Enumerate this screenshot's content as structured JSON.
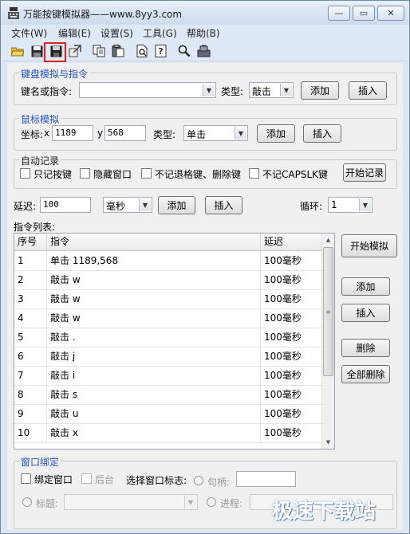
{
  "window": {
    "title": "万能按键模拟器——www.8yy3.com",
    "minimize_glyph": "—",
    "maximize_glyph": "▭",
    "close_glyph": "✕"
  },
  "menu": [
    "文件(W)",
    "编辑(E)",
    "设置(S)",
    "工具(G)",
    "帮助(B)"
  ],
  "toolbar": {
    "icons": [
      "open-folder-icon",
      "save-icon",
      "save-as-icon",
      "export-icon",
      "copy-icon",
      "paste-icon",
      "preview-icon",
      "help-icon",
      "search-icon",
      "tool-icon"
    ],
    "highlight_color": "#e02020"
  },
  "keyboard": {
    "title": "键盘模拟与指令",
    "key_label": "键名或指令:",
    "key_value": "",
    "type_label": "类型:",
    "type_value": "敲击",
    "add": "添加",
    "insert": "插入"
  },
  "mouse": {
    "title": "鼠标模拟",
    "coord_label": "坐标:",
    "x_label": "x",
    "x_value": "1189",
    "y_label": "y",
    "y_value": "568",
    "type_label": "类型:",
    "type_value": "单击",
    "add": "添加",
    "insert": "插入"
  },
  "autorec": {
    "title": "自动记录",
    "options": [
      "只记按键",
      "隐藏窗口",
      "不记退格键、删除键",
      "不记CAPSLK键"
    ],
    "start": "开始记录"
  },
  "delay": {
    "label": "延迟:",
    "value": "100",
    "unit": "毫秒",
    "add": "添加",
    "insert": "插入",
    "loop_label": "循环:",
    "loop_value": "1"
  },
  "list": {
    "title": "指令列表:",
    "headers": [
      "序号",
      "指令",
      "延迟"
    ],
    "rows": [
      [
        "1",
        "单击 1189,568",
        "100毫秒"
      ],
      [
        "2",
        "敲击 w",
        "100毫秒"
      ],
      [
        "3",
        "敲击 w",
        "100毫秒"
      ],
      [
        "4",
        "敲击 w",
        "100毫秒"
      ],
      [
        "5",
        "敲击 .",
        "100毫秒"
      ],
      [
        "6",
        "敲击 j",
        "100毫秒"
      ],
      [
        "7",
        "敲击 i",
        "100毫秒"
      ],
      [
        "8",
        "敲击 s",
        "100毫秒"
      ],
      [
        "9",
        "敲击 u",
        "100毫秒"
      ],
      [
        "10",
        "敲击 x",
        "100毫秒"
      ]
    ]
  },
  "side_buttons": {
    "start": "开始模拟",
    "add": "添加",
    "insert": "插入",
    "delete": "删除",
    "delete_all": "全部删除"
  },
  "bind": {
    "title": "窗口绑定",
    "bind_window": "绑定窗口",
    "background": "后台",
    "select_label": "选择窗口标志:",
    "handle_label": "句柄:",
    "handle_value": "",
    "title_label": "标题:",
    "process_label": "进程:"
  },
  "watermark": "极速下载站"
}
